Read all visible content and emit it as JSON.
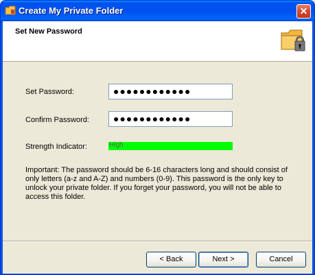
{
  "window": {
    "title": "Create My Private Folder"
  },
  "header": {
    "title": "Set New Password"
  },
  "form": {
    "set_password_label": "Set Password:",
    "set_password_value": "●●●●●●●●●●●●",
    "confirm_password_label": "Confirm Password:",
    "confirm_password_value": "●●●●●●●●●●●●",
    "strength_label": "Strength Indicator:",
    "strength_value": "High",
    "strength_level": 1.0
  },
  "note": "Important: The password should be 6-16 characters long and should consist of only letters (a-z and A-Z) and numbers (0-9). This password is the only key to unlock your private folder. If you forget your password, you will not be able to access this folder.",
  "buttons": {
    "back": "< Back",
    "next": "Next >",
    "cancel": "Cancel"
  },
  "colors": {
    "strength_bar": "#00ff00",
    "titlebar": "#0050ee"
  }
}
